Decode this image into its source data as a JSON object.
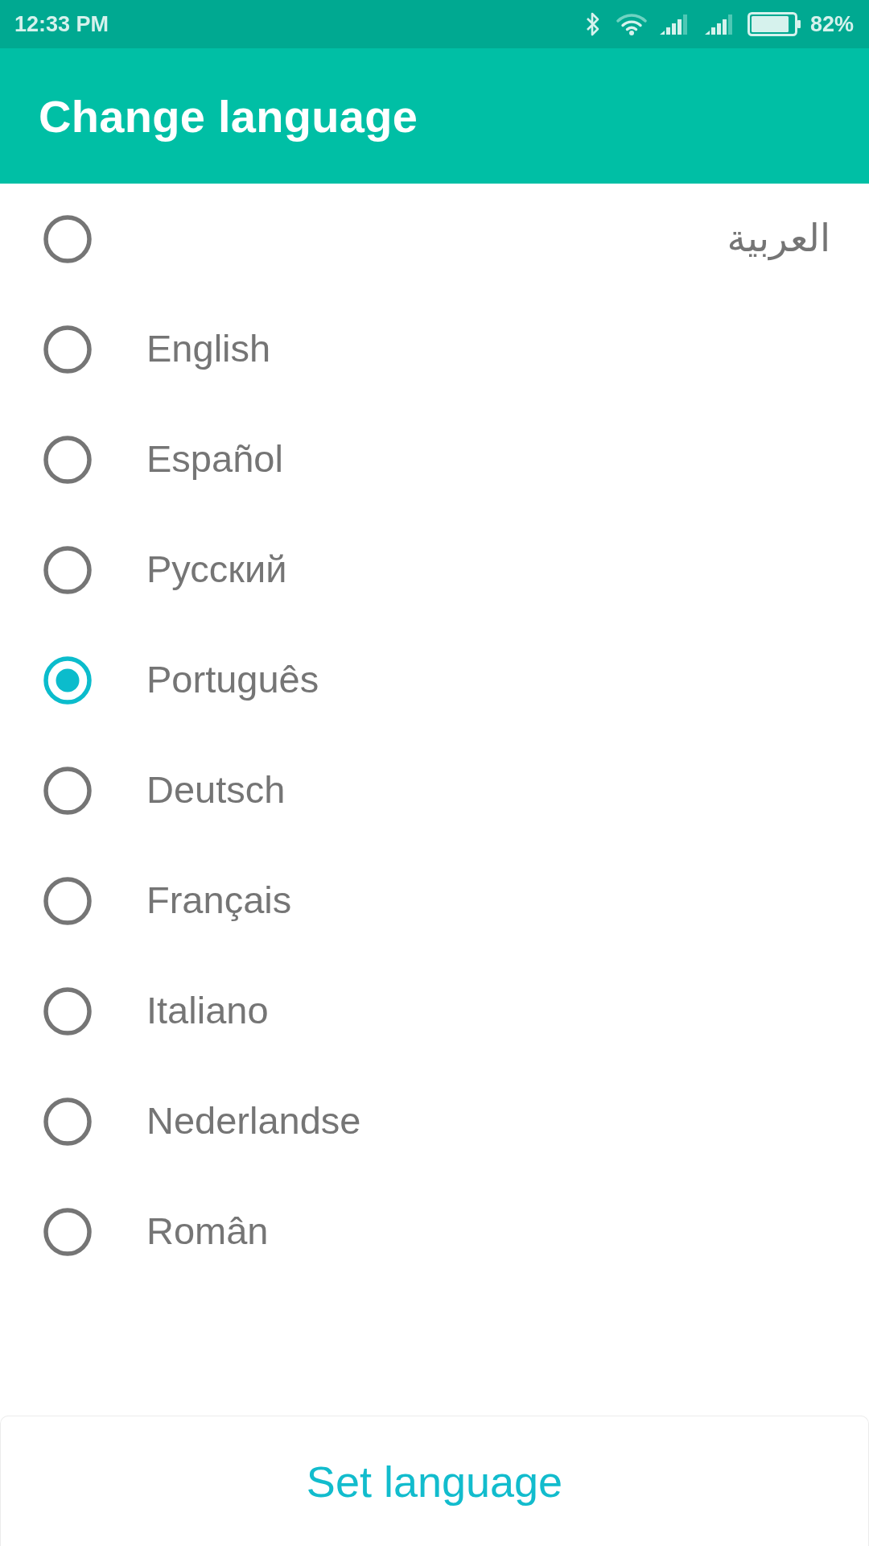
{
  "status_bar": {
    "time": "12:33 PM",
    "battery": "82%"
  },
  "app_bar": {
    "title": "Change language"
  },
  "languages": [
    {
      "label": "العربية",
      "selected": false
    },
    {
      "label": "English",
      "selected": false
    },
    {
      "label": "Español",
      "selected": false
    },
    {
      "label": "Русский",
      "selected": false
    },
    {
      "label": "Português",
      "selected": true
    },
    {
      "label": "Deutsch",
      "selected": false
    },
    {
      "label": "Français",
      "selected": false
    },
    {
      "label": "Italiano",
      "selected": false
    },
    {
      "label": "Nederlandse",
      "selected": false
    },
    {
      "label": "Român",
      "selected": false
    }
  ],
  "action_button": {
    "label": "Set language"
  }
}
